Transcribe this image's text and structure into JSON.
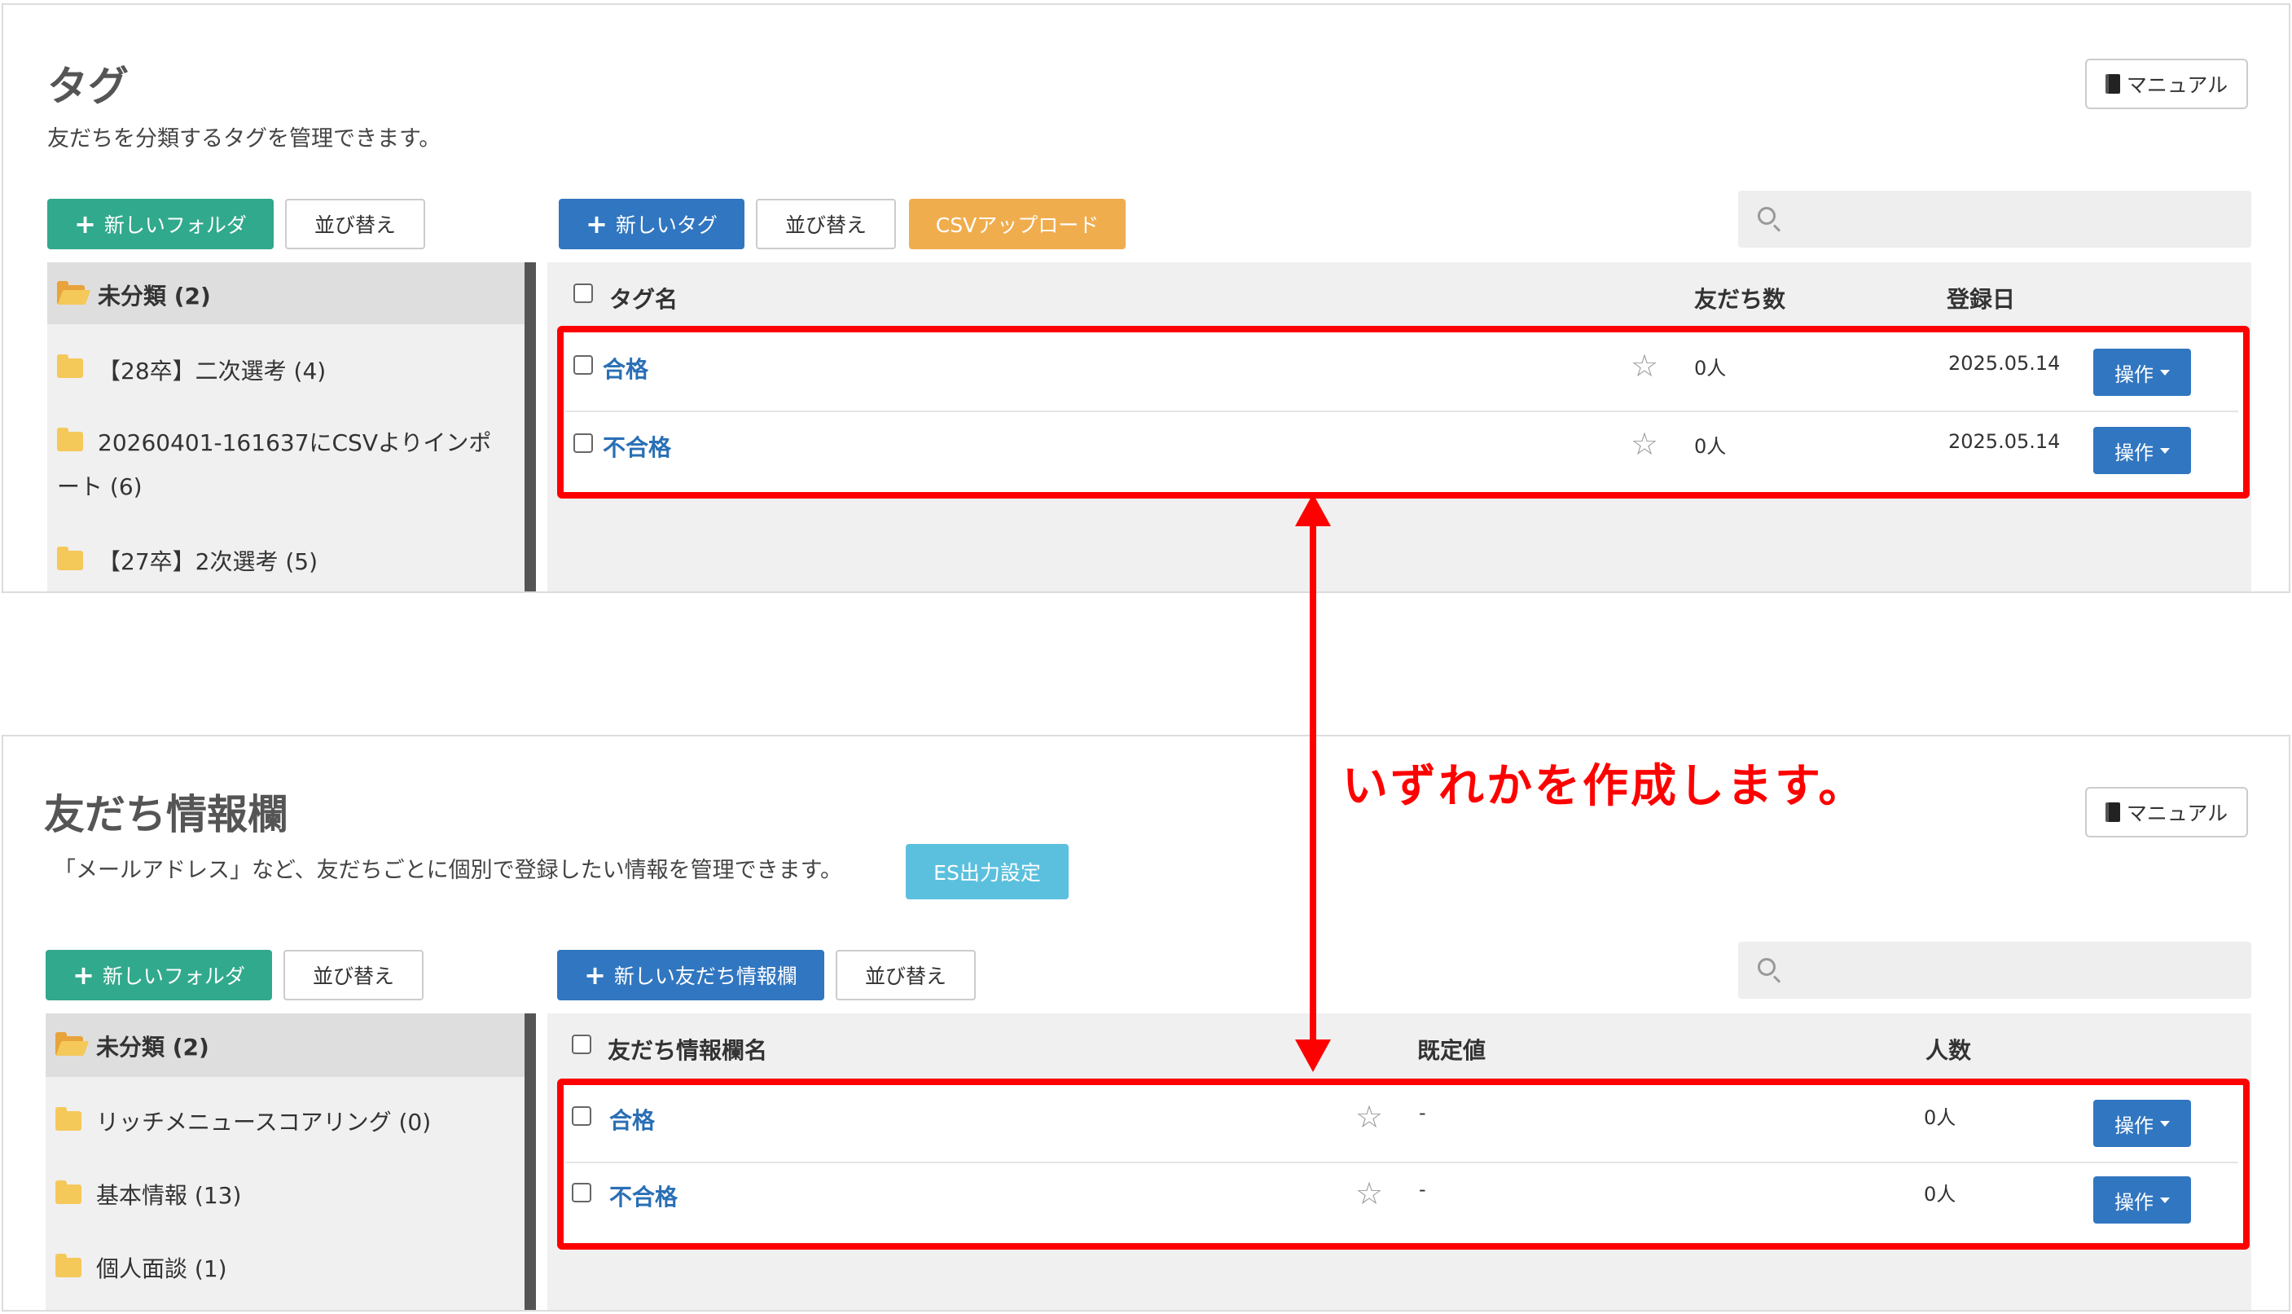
{
  "tags_panel": {
    "title": "タグ",
    "description": "友だちを分類するタグを管理できます。",
    "manual_label": "マニュアル",
    "new_folder_label": "新しいフォルダ",
    "sort_label": "並び替え",
    "new_tag_label": "新しいタグ",
    "sort_label_2": "並び替え",
    "csv_upload_label": "CSVアップロード",
    "sidebar": {
      "head": "未分類 (2)",
      "items": [
        "【28卒】二次選考 (4)",
        "20260401-161637にCSVよりインポ",
        "ート (6)",
        "【27卒】2次選考 (5)"
      ]
    },
    "columns": {
      "name": "タグ名",
      "friends": "友だち数",
      "date": "登録日"
    },
    "rows": [
      {
        "name": "合格",
        "friends": "0人",
        "date": "2025.05.14",
        "action": "操作"
      },
      {
        "name": "不合格",
        "friends": "0人",
        "date": "2025.05.14",
        "action": "操作"
      }
    ]
  },
  "info_panel": {
    "title": "友だち情報欄",
    "description": "「メールアドレス」など、友だちごとに個別で登録したい情報を管理できます。",
    "es_button_label": "ES出力設定",
    "manual_label": "マニュアル",
    "new_folder_label": "新しいフォルダ",
    "sort_label": "並び替え",
    "new_info_label": "新しい友だち情報欄",
    "sort_label_2": "並び替え",
    "sidebar": {
      "head": "未分類 (2)",
      "items": [
        "リッチメニュースコアリング (0)",
        "基本情報 (13)",
        "個人面談 (1)"
      ]
    },
    "columns": {
      "name": "友だち情報欄名",
      "default": "既定値",
      "count": "人数"
    },
    "rows": [
      {
        "name": "合格",
        "default": "-",
        "count": "0人",
        "action": "操作"
      },
      {
        "name": "不合格",
        "default": "-",
        "count": "0人",
        "action": "操作"
      }
    ]
  },
  "annotation": "いずれかを作成します。",
  "colors": {
    "annotation": "#ff0000",
    "primary": "#3176c0",
    "success": "#31a98c",
    "warning": "#f0ad4e",
    "info": "#5bc0de"
  }
}
